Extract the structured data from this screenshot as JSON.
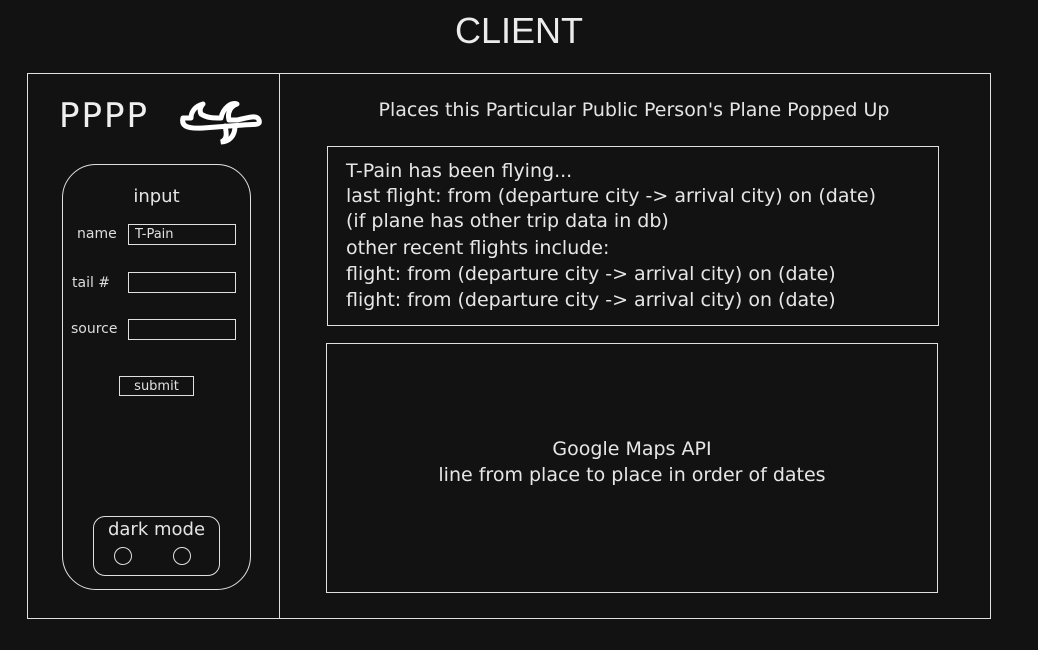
{
  "header": {
    "title": "CLIENT"
  },
  "sidebar": {
    "logo": "PPPP",
    "form": {
      "heading": "input",
      "name_label": "name",
      "name_value": "T-Pain",
      "tail_label": "tail #",
      "tail_value": "",
      "source_label": "source",
      "source_value": "",
      "submit_label": "submit"
    },
    "dark_mode": {
      "label": "dark mode"
    }
  },
  "main": {
    "heading": "Places this Particular Public Person's Plane Popped Up",
    "info_lines": [
      "T-Pain has been flying...",
      "last flight: from (departure city -> arrival city) on (date)",
      "(if plane has other trip data in db)",
      "other recent flights include:",
      "flight: from (departure city -> arrival city) on (date)",
      "flight: from (departure city -> arrival city) on (date)"
    ],
    "map": {
      "line1": "Google Maps API",
      "line2": "line from place to place in order of dates"
    }
  },
  "icons": {
    "logo_icon": "airplane-icon"
  }
}
